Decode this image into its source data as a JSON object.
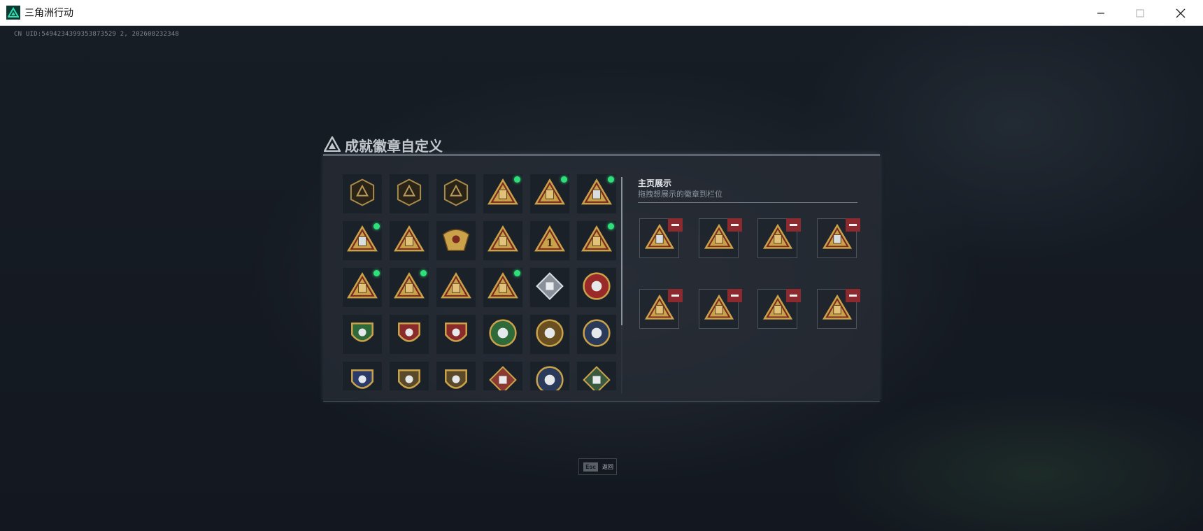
{
  "window": {
    "title": "三角洲行动",
    "controls": {
      "minimize": "—",
      "maximize": "☐",
      "close": "✕"
    }
  },
  "uid_text": "CN UID:5494234399353873529 2, 202608232348",
  "dialog": {
    "title": "成就徽章自定义",
    "showcase": {
      "title": "主页展示",
      "subtitle": "拖拽想展示的徽章到栏位"
    }
  },
  "badges": [
    {
      "icon": "delta-emblem-icon",
      "shape": "shield",
      "new": false
    },
    {
      "icon": "helicopter-badge-icon",
      "shape": "shield",
      "new": false
    },
    {
      "icon": "diamond-emblem-icon",
      "shape": "shield",
      "new": false
    },
    {
      "icon": "triangle-gold-badge-icon",
      "shape": "triangle",
      "new": true
    },
    {
      "icon": "triangle-gold-badge-icon",
      "shape": "triangle",
      "new": true
    },
    {
      "icon": "triangle-silver-badge-icon",
      "shape": "triangle",
      "new": true
    },
    {
      "icon": "triangle-silver-badge-icon",
      "shape": "triangle",
      "new": true
    },
    {
      "icon": "triangle-gold-badge-icon",
      "shape": "triangle",
      "new": false
    },
    {
      "icon": "eagle-crest-badge-icon",
      "shape": "crest",
      "new": false
    },
    {
      "icon": "triangle-gold-badge-icon",
      "shape": "triangle",
      "new": false
    },
    {
      "icon": "triangle-number-one-badge-icon",
      "shape": "triangle",
      "new": false
    },
    {
      "icon": "triangle-gold-badge-icon",
      "shape": "triangle",
      "new": true
    },
    {
      "icon": "triangle-gold-badge-icon",
      "shape": "triangle",
      "new": true
    },
    {
      "icon": "triangle-gold-badge-icon",
      "shape": "triangle",
      "new": true
    },
    {
      "icon": "triangle-gold-badge-icon",
      "shape": "triangle",
      "new": false
    },
    {
      "icon": "triangle-gold-badge-icon",
      "shape": "triangle",
      "new": true
    },
    {
      "icon": "silver-cube-badge-icon",
      "shape": "diamond",
      "new": false
    },
    {
      "icon": "red-star-medal-icon",
      "shape": "round",
      "new": false
    },
    {
      "icon": "green-shield-badge-icon",
      "shape": "shield-green",
      "new": false
    },
    {
      "icon": "star-shield-badge-icon",
      "shape": "shield-red",
      "new": false
    },
    {
      "icon": "star-shield-badge-icon",
      "shape": "shield-red",
      "new": false
    },
    {
      "icon": "skull-round-badge-icon",
      "shape": "round-green",
      "new": false
    },
    {
      "icon": "eye-round-badge-icon",
      "shape": "round-gold",
      "new": false
    },
    {
      "icon": "wolf-round-badge-icon",
      "shape": "round-blue",
      "new": false
    },
    {
      "icon": "wolf-shield-badge-icon",
      "shape": "shield-blue",
      "new": false
    },
    {
      "icon": "rifle-shield-badge-icon",
      "shape": "shield-gold",
      "new": false
    },
    {
      "icon": "wing-shield-badge-icon",
      "shape": "shield-gold",
      "new": false
    },
    {
      "icon": "beast-diamond-badge-icon",
      "shape": "diamond-red",
      "new": false
    },
    {
      "icon": "dragon-round-badge-icon",
      "shape": "round-blue",
      "new": false
    },
    {
      "icon": "eagle-diamond-badge-icon",
      "shape": "diamond-green",
      "new": false
    }
  ],
  "showcase_slots": [
    {
      "icon": "triangle-silver-badge-icon",
      "remove_label": "remove"
    },
    {
      "icon": "triangle-gold-badge-icon",
      "remove_label": "remove"
    },
    {
      "icon": "triangle-gold-badge-icon",
      "remove_label": "remove"
    },
    {
      "icon": "triangle-silver-badge-icon",
      "remove_label": "remove"
    },
    {
      "icon": "triangle-gold-badge-icon",
      "remove_label": "remove"
    },
    {
      "icon": "triangle-gold-badge-icon",
      "remove_label": "remove"
    },
    {
      "icon": "triangle-gold-badge-icon",
      "remove_label": "remove"
    },
    {
      "icon": "triangle-gold-badge-icon",
      "remove_label": "remove"
    }
  ],
  "back": {
    "key": "Esc",
    "label": "返回"
  },
  "colors": {
    "accent_green": "#2ee07a",
    "remove_red": "#8c2a2f",
    "badge_gold": "#c9a24a"
  }
}
